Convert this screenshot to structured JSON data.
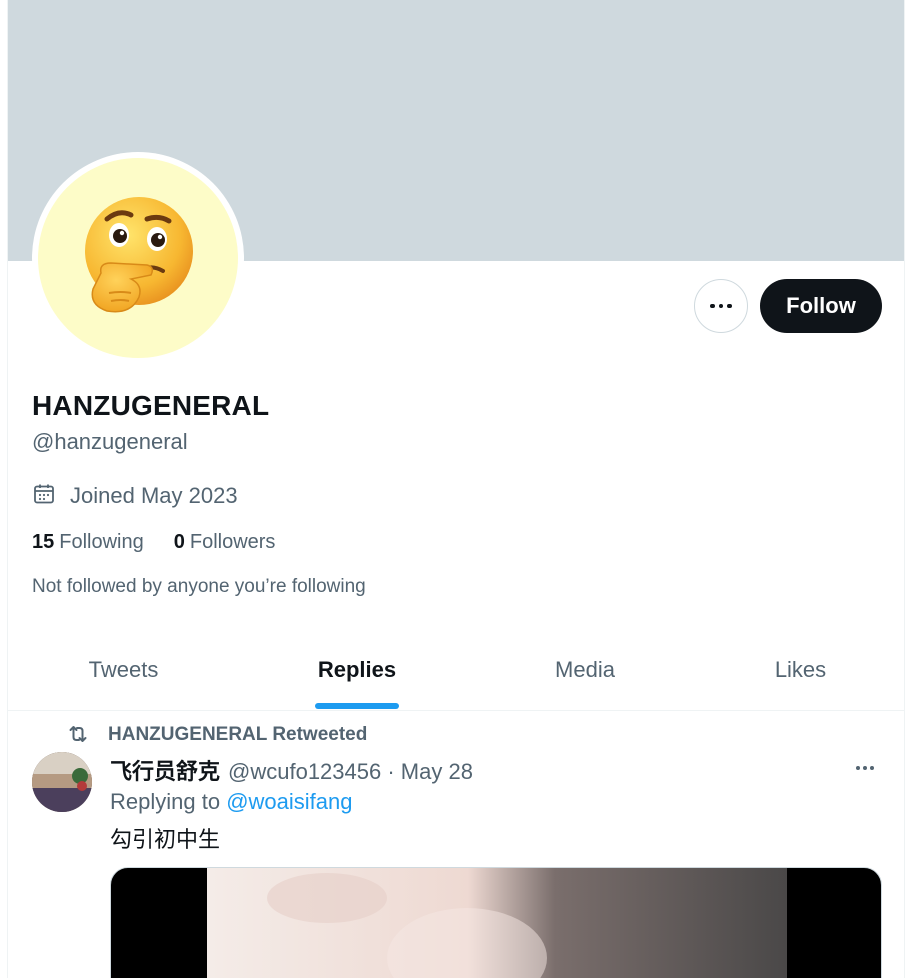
{
  "profile": {
    "display_name": "HANZUGENERAL",
    "handle": "@hanzugeneral",
    "joined": "Joined May 2023",
    "following_count": "15",
    "following_label": "Following",
    "followers_count": "0",
    "followers_label": "Followers",
    "not_followed_text": "Not followed by anyone you’re following",
    "avatar_icon": "thinking-face-emoji",
    "banner_color": "#cfd9de",
    "avatar_bg_color": "#fdfcc8"
  },
  "actions": {
    "follow_label": "Follow",
    "more_icon": "ellipsis-icon"
  },
  "tabs": [
    {
      "label": "Tweets",
      "active": false
    },
    {
      "label": "Replies",
      "active": true
    },
    {
      "label": "Media",
      "active": false
    },
    {
      "label": "Likes",
      "active": false
    }
  ],
  "tweet": {
    "retweet_label": "HANZUGENERAL Retweeted",
    "author_name": "飞行员舒克",
    "author_meta": "@wcufo123456 · May 28",
    "replying_prefix": "Replying to",
    "replying_mention": "@woaisifang",
    "text": "勾引初中生"
  },
  "colors": {
    "accent": "#1d9bf0",
    "text_primary": "#0f1419",
    "text_secondary": "#536471",
    "follow_button": "#0f1419"
  }
}
